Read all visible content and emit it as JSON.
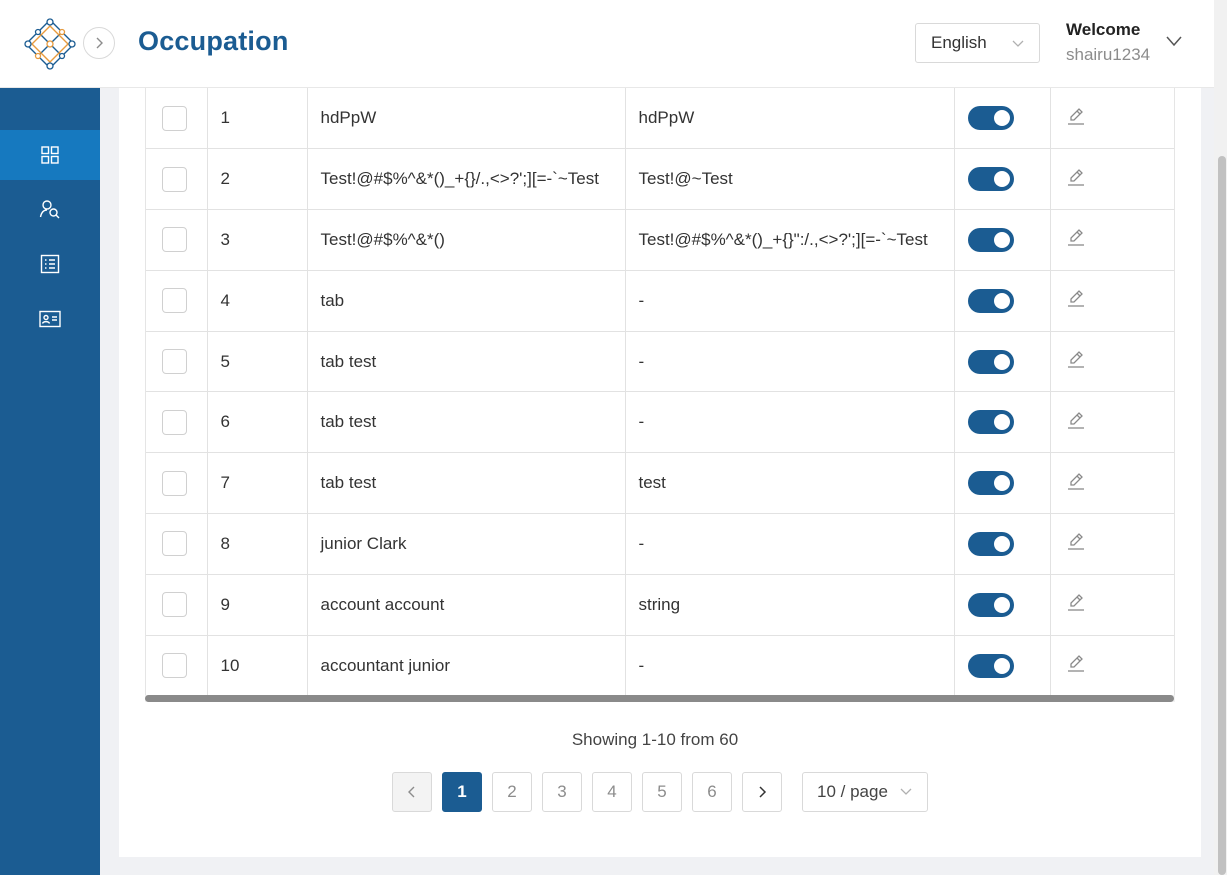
{
  "header": {
    "title": "Occupation",
    "language": "English",
    "welcome": "Welcome",
    "username": "shairu1234"
  },
  "sidebar": {
    "items": [
      {
        "icon": "dashboard-icon",
        "active": true
      },
      {
        "icon": "user-search-icon",
        "active": false
      },
      {
        "icon": "list-icon",
        "active": false
      },
      {
        "icon": "id-card-icon",
        "active": false
      }
    ]
  },
  "table": {
    "rows": [
      {
        "no": "1",
        "name": "hdPpW",
        "description": "hdPpW",
        "active": true
      },
      {
        "no": "2",
        "name": "Test!@#$%^&*()_+{}/.,<>?';][=-`~Test",
        "description": "Test!@~Test",
        "active": true
      },
      {
        "no": "3",
        "name": "Test!@#$%^&*()",
        "description": "Test!@#$%^&*()_+{}\":/.,<>?';][=-`~Test",
        "active": true
      },
      {
        "no": "4",
        "name": "tab",
        "description": "-",
        "active": true
      },
      {
        "no": "5",
        "name": "tab test",
        "description": "-",
        "active": true
      },
      {
        "no": "6",
        "name": "tab test",
        "description": "-",
        "active": true
      },
      {
        "no": "7",
        "name": "tab test",
        "description": "test",
        "active": true
      },
      {
        "no": "8",
        "name": "junior Clark",
        "description": "-",
        "active": true
      },
      {
        "no": "9",
        "name": "account account",
        "description": "string",
        "active": true
      },
      {
        "no": "10",
        "name": "accountant junior",
        "description": "-",
        "active": true
      }
    ]
  },
  "pagination": {
    "summary": "Showing 1-10 from 60",
    "pages": [
      "1",
      "2",
      "3",
      "4",
      "5",
      "6"
    ],
    "current": "1",
    "page_size": "10 / page"
  },
  "colors": {
    "primary": "#1b5c92",
    "sidebar_active": "#1679bf"
  }
}
